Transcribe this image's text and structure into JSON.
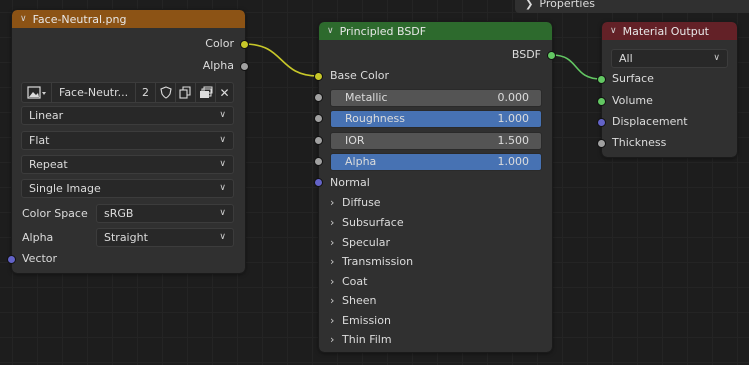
{
  "properties_panel": {
    "label": "Properties"
  },
  "image_node": {
    "title": "Face-Neutral.png",
    "header_color": "#8c5315",
    "outputs": [
      "Color",
      "Alpha"
    ],
    "image_name": "Face-Neutr...",
    "user_count": "2",
    "interpolation": "Linear",
    "projection": "Flat",
    "extension": "Repeat",
    "source": "Single Image",
    "color_space_label": "Color Space",
    "color_space": "sRGB",
    "alpha_label": "Alpha",
    "alpha_mode": "Straight",
    "input_vector": "Vector"
  },
  "bsdf_node": {
    "title": "Principled BSDF",
    "header_color": "#2d6a2d",
    "output": "BSDF",
    "base_color": "Base Color",
    "fields": [
      {
        "label": "Metallic",
        "value": "0.000",
        "style": "gray"
      },
      {
        "label": "Roughness",
        "value": "1.000",
        "style": "blue"
      },
      {
        "label": "IOR",
        "value": "1.500",
        "style": "gray"
      },
      {
        "label": "Alpha",
        "value": "1.000",
        "style": "blue"
      }
    ],
    "normal": "Normal",
    "panels": [
      "Diffuse",
      "Subsurface",
      "Specular",
      "Transmission",
      "Coat",
      "Sheen",
      "Emission",
      "Thin Film"
    ]
  },
  "output_node": {
    "title": "Material Output",
    "header_color": "#632127",
    "target": "All",
    "inputs": [
      "Surface",
      "Volume",
      "Displacement",
      "Thickness"
    ]
  },
  "colors": {
    "color_socket": "#c7c729",
    "gray_socket": "#a1a1a1",
    "shader_socket": "#63c763",
    "vector_socket": "#6363c7",
    "link_color_wire": "#c7c729",
    "link_shader_wire": "#63c763"
  }
}
